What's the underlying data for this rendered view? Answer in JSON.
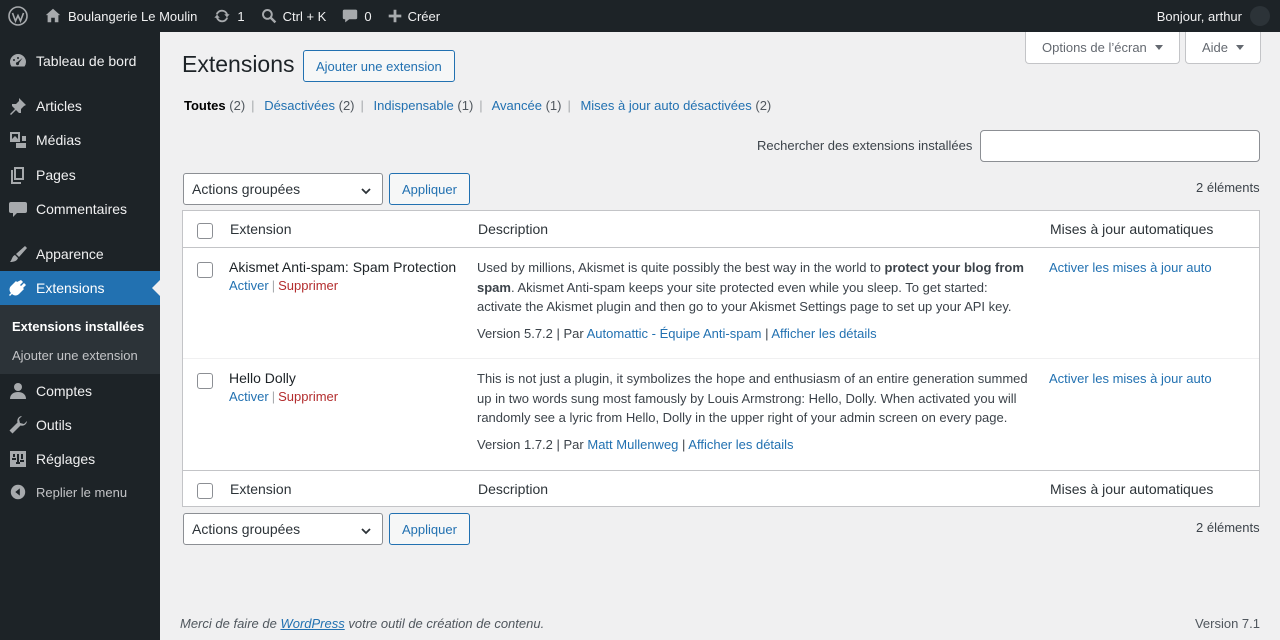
{
  "adminbar": {
    "site_name": "Boulangerie Le Moulin",
    "updates_count": "1",
    "search_shortcut": "Ctrl + K",
    "comments_count": "0",
    "new_label": "Créer",
    "greeting": "Bonjour, arthur"
  },
  "sidebar": {
    "items": [
      {
        "label": "Tableau de bord",
        "icon": "dashboard-icon"
      },
      {
        "label": "Articles",
        "icon": "pushpin-icon"
      },
      {
        "label": "Médias",
        "icon": "media-icon"
      },
      {
        "label": "Pages",
        "icon": "pages-icon"
      },
      {
        "label": "Commentaires",
        "icon": "comment-icon"
      },
      {
        "label": "Apparence",
        "icon": "brush-icon"
      },
      {
        "label": "Extensions",
        "icon": "plugin-icon"
      },
      {
        "label": "Comptes",
        "icon": "user-icon"
      },
      {
        "label": "Outils",
        "icon": "wrench-icon"
      },
      {
        "label": "Réglages",
        "icon": "settings-icon"
      }
    ],
    "submenu": [
      "Extensions installées",
      "Ajouter une extension"
    ],
    "collapse_label": "Replier le menu"
  },
  "screen_meta": {
    "screen_options": "Options de l’écran",
    "help": "Aide"
  },
  "page": {
    "title": "Extensions",
    "add_new": "Ajouter une extension"
  },
  "filters": [
    {
      "label": "Toutes",
      "count": "(2)"
    },
    {
      "label": "Désactivées",
      "count": "(2)"
    },
    {
      "label": "Indispensable",
      "count": "(1)"
    },
    {
      "label": "Avancée",
      "count": "(1)"
    },
    {
      "label": "Mises à jour auto désactivées",
      "count": "(2)"
    }
  ],
  "search": {
    "label": "Rechercher des extensions installées",
    "value": ""
  },
  "bulk": {
    "selected": "Actions groupées",
    "apply": "Appliquer",
    "items_count": "2 éléments"
  },
  "table": {
    "columns": {
      "extension": "Extension",
      "description": "Description",
      "auto_updates": "Mises à jour automatiques"
    },
    "plugins": [
      {
        "name": "Akismet Anti-spam: Spam Protection",
        "activate": "Activer",
        "delete": "Supprimer",
        "desc_before": "Used by millions, Akismet is quite possibly the best way in the world to ",
        "desc_bold": "protect your blog from spam",
        "desc_after": ". Akismet Anti-spam keeps your site protected even while you sleep. To get started: activate the Akismet plugin and then go to your Akismet Settings page to set up your API key.",
        "version": "Version 5.7.2",
        "by": "Par",
        "author": "Automattic - Équipe Anti-spam",
        "details": "Afficher les détails",
        "auto_update": "Activer les mises à jour auto"
      },
      {
        "name": "Hello Dolly",
        "activate": "Activer",
        "delete": "Supprimer",
        "desc": "This is not just a plugin, it symbolizes the hope and enthusiasm of an entire generation summed up in two words sung most famously by Louis Armstrong: Hello, Dolly. When activated you will randomly see a lyric from Hello, Dolly in the upper right of your admin screen on every page.",
        "version": "Version 1.7.2",
        "by": "Par",
        "author": "Matt Mullenweg",
        "details": "Afficher les détails",
        "auto_update": "Activer les mises à jour auto"
      }
    ]
  },
  "footer": {
    "thanks_before": "Merci de faire de ",
    "thanks_link": "WordPress",
    "thanks_after": " votre outil de création de contenu.",
    "version": "Version 7.1"
  },
  "colors": {
    "accent": "#2271b1",
    "adminbar": "#1d2327",
    "delete": "#b32d2e"
  }
}
